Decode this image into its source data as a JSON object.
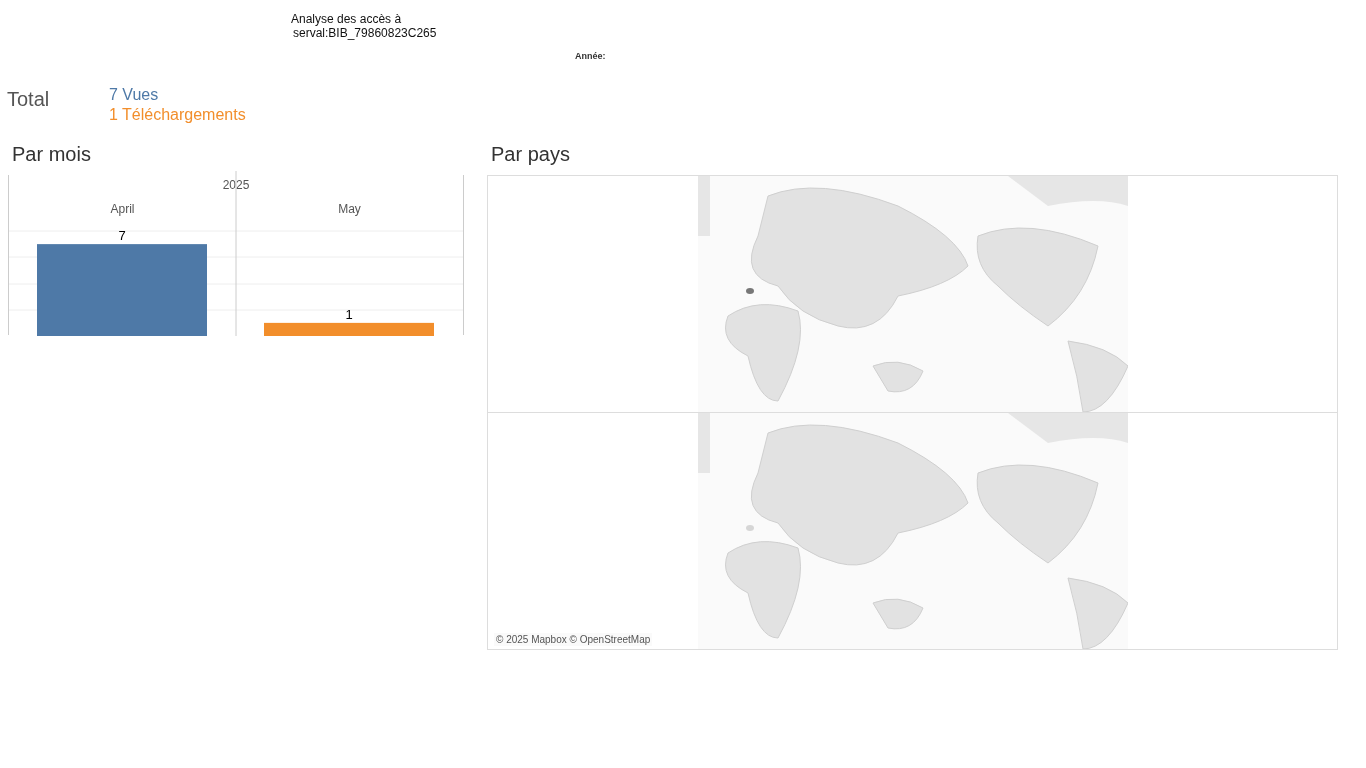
{
  "header": {
    "title_lines": [
      "Analyse des accès à",
      "serval:BIB_79860823C265"
    ],
    "year_filter_label": "Année:"
  },
  "totals": {
    "label": "Total",
    "items": [
      {
        "text": "7 Vues",
        "color": "#4e79a7"
      },
      {
        "text": "1 Téléchargements",
        "color": "#f28e2b"
      }
    ]
  },
  "by_month": {
    "title": "Par mois",
    "year_header": "2025",
    "bars": [
      {
        "color": "#4e79a7"
      },
      {
        "color": "#f28e2b"
      }
    ],
    "chart_data": {
      "type": "bar",
      "categories": [
        "April",
        "May"
      ],
      "values": [
        7,
        1
      ],
      "data_labels": true
    }
  },
  "by_country": {
    "title": "Par pays",
    "maps": [
      {
        "highlighted": true
      },
      {
        "highlighted": false
      }
    ],
    "attribution": "© 2025 Mapbox © OpenStreetMap"
  }
}
